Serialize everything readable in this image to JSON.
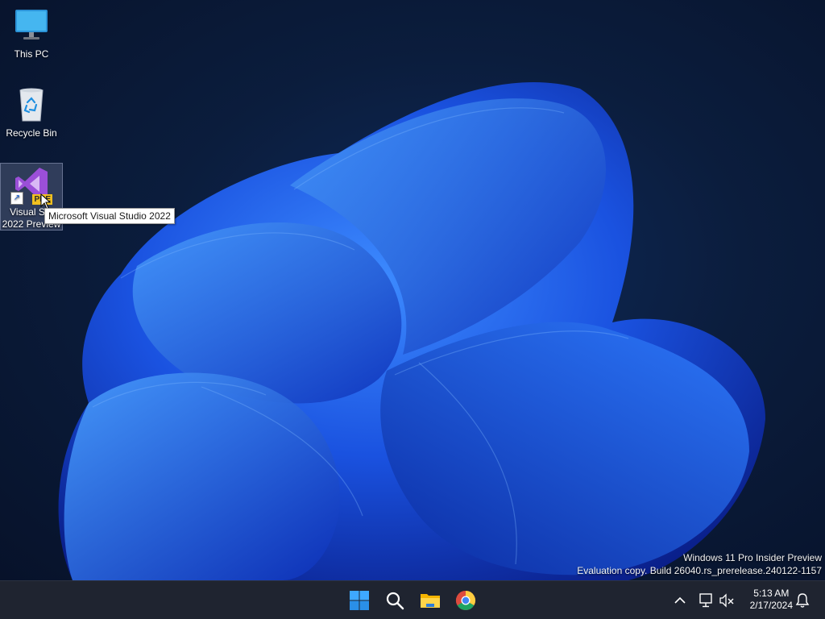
{
  "desktop": {
    "icons": [
      {
        "label": "This PC"
      },
      {
        "label": "Recycle Bin"
      },
      {
        "label": "Visual Studio 2022 Preview",
        "line1": "Visual Stu",
        "line2": "2022 Preview",
        "badge": "PRE"
      }
    ],
    "tooltip": "Microsoft Visual Studio 2022"
  },
  "watermark": {
    "line1": "Windows 11 Pro Insider Preview",
    "line2": "Evaluation copy. Build 26040.rs_prerelease.240122-1157"
  },
  "taskbar": {
    "apps": [
      {
        "icon": "windows-start-icon"
      },
      {
        "icon": "search-icon"
      },
      {
        "icon": "file-explorer-icon"
      },
      {
        "icon": "chrome-icon"
      }
    ],
    "tray": [
      "chevron-up-icon",
      "network-icon",
      "volume-muted-icon",
      "notification-bell-icon"
    ],
    "clock": {
      "time": "5:13 AM",
      "date": "2/17/2024"
    }
  },
  "colors": {
    "accent": "#1e6fe8",
    "taskbar": "#1f2430"
  }
}
